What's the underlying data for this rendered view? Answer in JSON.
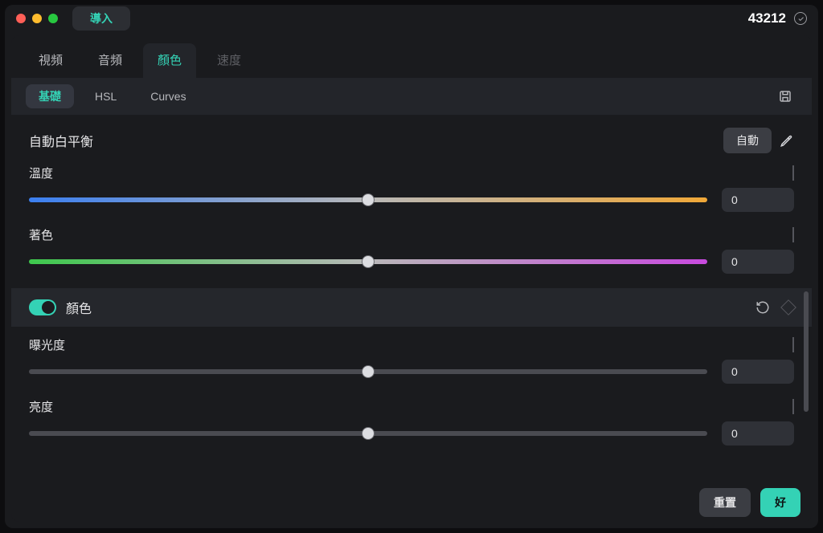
{
  "titlebar": {
    "import_label": "導入",
    "number": "43212"
  },
  "tabs": {
    "video": "視頻",
    "audio": "音頻",
    "color": "顏色",
    "speed": "速度"
  },
  "subtabs": {
    "basic": "基礎",
    "hsl": "HSL",
    "curves": "Curves"
  },
  "wb": {
    "section": "自動白平衡",
    "auto": "自動",
    "temperature": {
      "label": "溫度",
      "value": "0"
    },
    "tint": {
      "label": "著色",
      "value": "0"
    }
  },
  "color_group": {
    "label": "顏色"
  },
  "exposure": {
    "label": "曝光度",
    "value": "0"
  },
  "brightness": {
    "label": "亮度",
    "value": "0"
  },
  "footer": {
    "reset": "重置",
    "ok": "好"
  }
}
